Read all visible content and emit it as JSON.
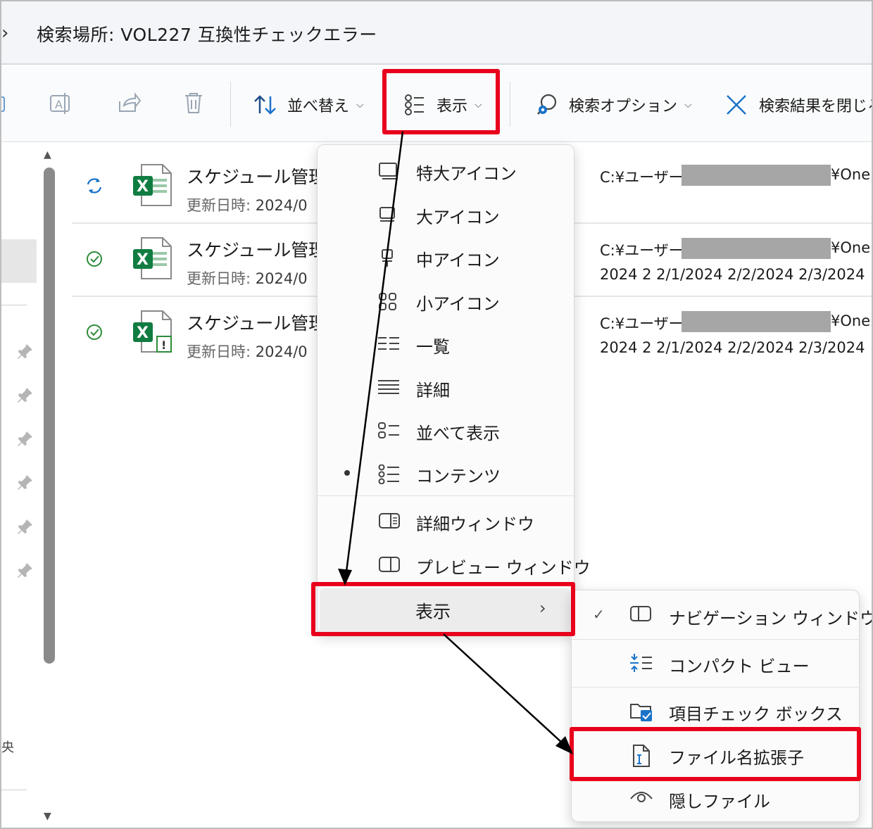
{
  "address": {
    "chevron": "›",
    "text": "検索場所: VOL227 互換性チェックエラー"
  },
  "toolbar": {
    "sort_label": "並べ替え",
    "view_label": "表示",
    "search_options_label": "検索オプション",
    "close_search_label": "検索結果を閉じる"
  },
  "files": [
    {
      "name": "スケジュール管理",
      "date_label": "更新日時:",
      "date_value": "2024/0",
      "path_prefix": "C:¥ユーザー¥",
      "path_suffix": "¥One",
      "tags": "",
      "status": "sync"
    },
    {
      "name": "スケジュール管理",
      "date_label": "更新日時:",
      "date_value": "2024/0",
      "path_prefix": "C:¥ユーザー¥",
      "path_suffix": "¥One",
      "tags": "2024 2 2/1/2024 2/2/2024 2/3/2024",
      "status": "available"
    },
    {
      "name": "スケジュール管理",
      "date_label": "更新日時:",
      "date_value": "2024/0",
      "path_prefix": "C:¥ユーザー¥",
      "path_suffix": "¥One",
      "tags": "2024 2 2/1/2024 2/2/2024 2/3/2024",
      "status": "available"
    }
  ],
  "view_menu": {
    "items": [
      {
        "label": "特大アイコン",
        "icon": "extra-large-icons-icon"
      },
      {
        "label": "大アイコン",
        "icon": "large-icons-icon"
      },
      {
        "label": "中アイコン",
        "icon": "medium-icons-icon"
      },
      {
        "label": "小アイコン",
        "icon": "small-icons-icon"
      },
      {
        "label": "一覧",
        "icon": "list-icon"
      },
      {
        "label": "詳細",
        "icon": "details-icon"
      },
      {
        "label": "並べて表示",
        "icon": "tiles-icon"
      },
      {
        "label": "コンテンツ",
        "icon": "content-icon",
        "selected": true
      }
    ],
    "panes": [
      {
        "label": "詳細ウィンドウ",
        "icon": "details-pane-icon"
      },
      {
        "label": "プレビュー ウィンドウ",
        "icon": "preview-pane-icon"
      }
    ],
    "show_label": "表示",
    "show_chevron": "›"
  },
  "show_submenu": {
    "items": [
      {
        "label": "ナビゲーション ウィンドウ",
        "checked": true,
        "check": "✓"
      },
      {
        "label": "コンパクト ビュー"
      },
      {
        "label": "項目チェック ボックス"
      },
      {
        "label": "ファイル名拡張子"
      },
      {
        "label": "隠しファイル"
      }
    ]
  },
  "nav": {
    "partial_char": "央"
  },
  "colors": {
    "highlight": "#e8001c",
    "excel_green": "#107c41",
    "sync_blue": "#1a73c8",
    "ok_green": "#2e8b3a"
  }
}
